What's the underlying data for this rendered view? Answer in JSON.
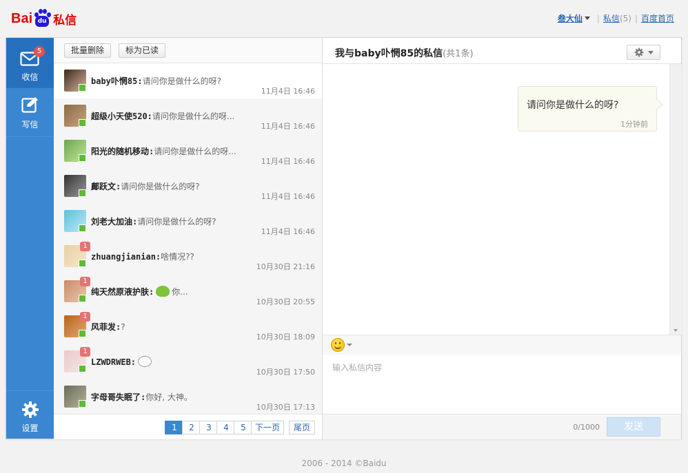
{
  "brand": {
    "logo_left": "Bai",
    "logo_paw": "du",
    "logo_right": "私信",
    "colors": {
      "red": "#e10601",
      "blue": "#2319dc"
    }
  },
  "top_links": {
    "user": "叁大仙",
    "messages_label": "私信",
    "messages_count": "(5)",
    "home_label": "百度首页"
  },
  "nav": {
    "inbox_label": "收信",
    "inbox_badge": "5",
    "write_label": "写信",
    "settings_label": "设置",
    "colors": {
      "bar": "#3b86d0",
      "active": "#2670bd"
    }
  },
  "toolbar": {
    "batch_delete": "批量删除",
    "mark_read": "标为已读"
  },
  "conversations": [
    {
      "sender": "baby卟惘85",
      "message": "请问你是做什么的呀?",
      "time": "11月4日 16:46",
      "badge": "",
      "emoji": "",
      "active": true
    },
    {
      "sender": "超级小天使520",
      "message": "请问你是做什么的呀...",
      "time": "11月4日 16:46",
      "badge": "",
      "emoji": ""
    },
    {
      "sender": "阳光的随机移动",
      "message": "请问你是做什么的呀...",
      "time": "11月4日 16:46",
      "badge": "",
      "emoji": ""
    },
    {
      "sender": "鄺跃文",
      "message": "请问你是做什么的呀?",
      "time": "11月4日 16:46",
      "badge": "",
      "emoji": ""
    },
    {
      "sender": "刘老大加油",
      "message": "请问你是做什么的呀?",
      "time": "11月4日 16:46",
      "badge": "",
      "emoji": ""
    },
    {
      "sender": "zhuangjianian",
      "message": "啥情况??",
      "time": "10月30日 21:16",
      "badge": "1",
      "emoji": ""
    },
    {
      "sender": "纯天然原液护肤",
      "message": "你...",
      "time": "10月30日 20:55",
      "badge": "1",
      "emoji": "frog"
    },
    {
      "sender": "风菲发",
      "message": "?",
      "time": "10月30日 18:09",
      "badge": "1",
      "emoji": ""
    },
    {
      "sender": "LZWDRWEB",
      "message": "",
      "time": "10月30日 17:50",
      "badge": "1",
      "emoji": "sheep"
    },
    {
      "sender": "字母哥失眠了",
      "message": "你好, 大神。",
      "time": "10月30日 17:13",
      "badge": "",
      "emoji": ""
    }
  ],
  "pagination": {
    "pages": [
      "1",
      "2",
      "3",
      "4",
      "5"
    ],
    "current": "1",
    "next": "下一页",
    "last": "尾页"
  },
  "chat": {
    "title": "我与baby卟惘85的私信",
    "count": "(共1条)",
    "messages": [
      {
        "text": "请问你是做什么的呀?",
        "time": "1分钟前"
      }
    ],
    "input_placeholder": "输入私信内容",
    "char_count": "0/1000",
    "send_label": "发送"
  },
  "footer": "2006 - 2014 ©Baidu"
}
